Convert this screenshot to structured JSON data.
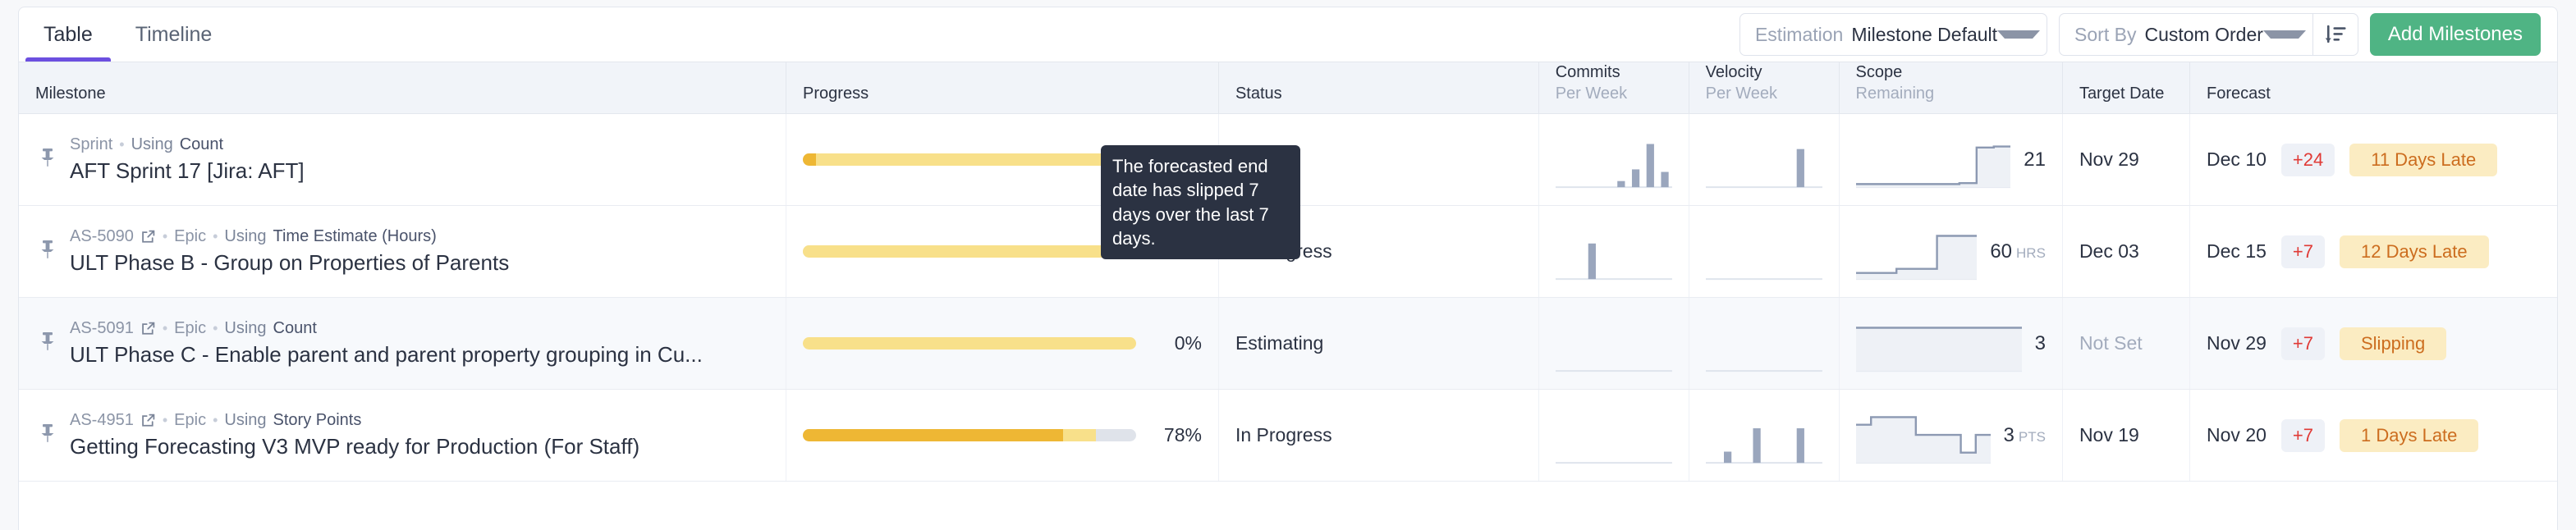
{
  "tabs": [
    {
      "label": "Table",
      "active": true
    },
    {
      "label": "Timeline",
      "active": false
    }
  ],
  "toolbar": {
    "estimation": {
      "label": "Estimation",
      "value": "Milestone Default"
    },
    "sort_by": {
      "label": "Sort By",
      "value": "Custom Order"
    },
    "sort_direction_icon": "sort-descending-icon",
    "add_button": "Add Milestones",
    "accent_green": "#4fb484",
    "accent_purple": "#6c4fe0"
  },
  "table": {
    "columns": [
      {
        "title": "Milestone",
        "sub": ""
      },
      {
        "title": "Progress",
        "sub": ""
      },
      {
        "title": "Status",
        "sub": ""
      },
      {
        "title": "Commits",
        "sub": "Per Week"
      },
      {
        "title": "Velocity",
        "sub": "Per Week"
      },
      {
        "title": "Scope",
        "sub": "Remaining"
      },
      {
        "title": "Target Date",
        "sub": ""
      },
      {
        "title": "Forecast",
        "sub": ""
      }
    ],
    "rows": [
      {
        "pin_icon": "pin-icon",
        "key": "",
        "has_link": false,
        "type": "Sprint",
        "using_label": "Using",
        "using_value": "Count",
        "title": "AFT Sprint 17 [Jira: AFT]",
        "progress_pct": "4%",
        "progress_done": 4,
        "progress_mid": 92,
        "status": "—",
        "commits": [
          0,
          0,
          0,
          0,
          0.12,
          0.35,
          0.85,
          0.3
        ],
        "velocity": [
          0,
          0,
          0,
          0,
          0,
          0,
          0.75,
          0
        ],
        "scope_series": [
          0.06,
          0.06,
          0.06,
          0.06,
          0.06,
          0.06,
          0.08,
          0.78,
          0.8
        ],
        "scope_value": "21",
        "scope_unit": "",
        "target_date": "Nov 29",
        "target_set": true,
        "forecast_date": "Dec 10",
        "delta": "+24",
        "late_label": "11 Days Late",
        "alt_row": false
      },
      {
        "pin_icon": "pin-icon",
        "key": "AS-5090",
        "has_link": true,
        "type": "Epic",
        "using_label": "Using",
        "using_value": "Time Estimate (Hours)",
        "title": "ULT Phase B - Group on Properties of Parents",
        "progress_pct": "0%",
        "progress_done": 0,
        "progress_mid": 95,
        "status": "In Progress",
        "commits": [
          0,
          0,
          0.7,
          0,
          0,
          0,
          0,
          0
        ],
        "velocity": [
          0,
          0,
          0,
          0,
          0,
          0,
          0,
          0
        ],
        "scope_series": [
          0.12,
          0.12,
          0.12,
          0.2,
          0.2,
          0.2,
          0.85,
          0.85,
          0.85
        ],
        "scope_value": "60",
        "scope_unit": "HRS",
        "target_date": "Dec 03",
        "target_set": true,
        "forecast_date": "Dec 15",
        "delta": "+7",
        "late_label": "12 Days Late",
        "alt_row": false
      },
      {
        "pin_icon": "pin-icon",
        "key": "AS-5091",
        "has_link": true,
        "type": "Epic",
        "using_label": "Using",
        "using_value": "Count",
        "title": "ULT Phase C - Enable parent and parent property grouping in Cu...",
        "progress_pct": "0%",
        "progress_done": 0,
        "progress_mid": 100,
        "status": "Estimating",
        "commits": [
          0,
          0,
          0,
          0,
          0,
          0,
          0,
          0
        ],
        "velocity": [
          0,
          0,
          0,
          0,
          0,
          0,
          0,
          0
        ],
        "scope_series": [
          0.85,
          0.85,
          0.85,
          0.85,
          0.85,
          0.85,
          0.85,
          0.85,
          0.85
        ],
        "scope_value": "3",
        "scope_unit": "",
        "target_date": "Not Set",
        "target_set": false,
        "forecast_date": "Nov 29",
        "delta": "+7",
        "late_label": "Slipping",
        "alt_row": true
      },
      {
        "pin_icon": "pin-icon",
        "key": "AS-4951",
        "has_link": true,
        "type": "Epic",
        "using_label": "Using",
        "using_value": "Story Points",
        "title": "Getting Forecasting V3 MVP ready for Production (For Staff)",
        "progress_pct": "78%",
        "progress_done": 78,
        "progress_mid": 10,
        "status": "In Progress",
        "commits": [
          0,
          0,
          0,
          0,
          0,
          0,
          0,
          0
        ],
        "velocity": [
          0,
          0.22,
          0,
          0.68,
          0,
          0,
          0.68,
          0
        ],
        "scope_series": [
          0.75,
          0.9,
          0.9,
          0.9,
          0.55,
          0.55,
          0.55,
          0.2,
          0.55
        ],
        "scope_value": "3",
        "scope_unit": "PTS",
        "target_date": "Nov 19",
        "target_set": true,
        "forecast_date": "Nov 20",
        "delta": "+7",
        "late_label": "1 Days Late",
        "alt_row": false
      }
    ]
  },
  "tooltip": {
    "text": "The forecasted end date has slipped 7 days over the last 7 days."
  }
}
